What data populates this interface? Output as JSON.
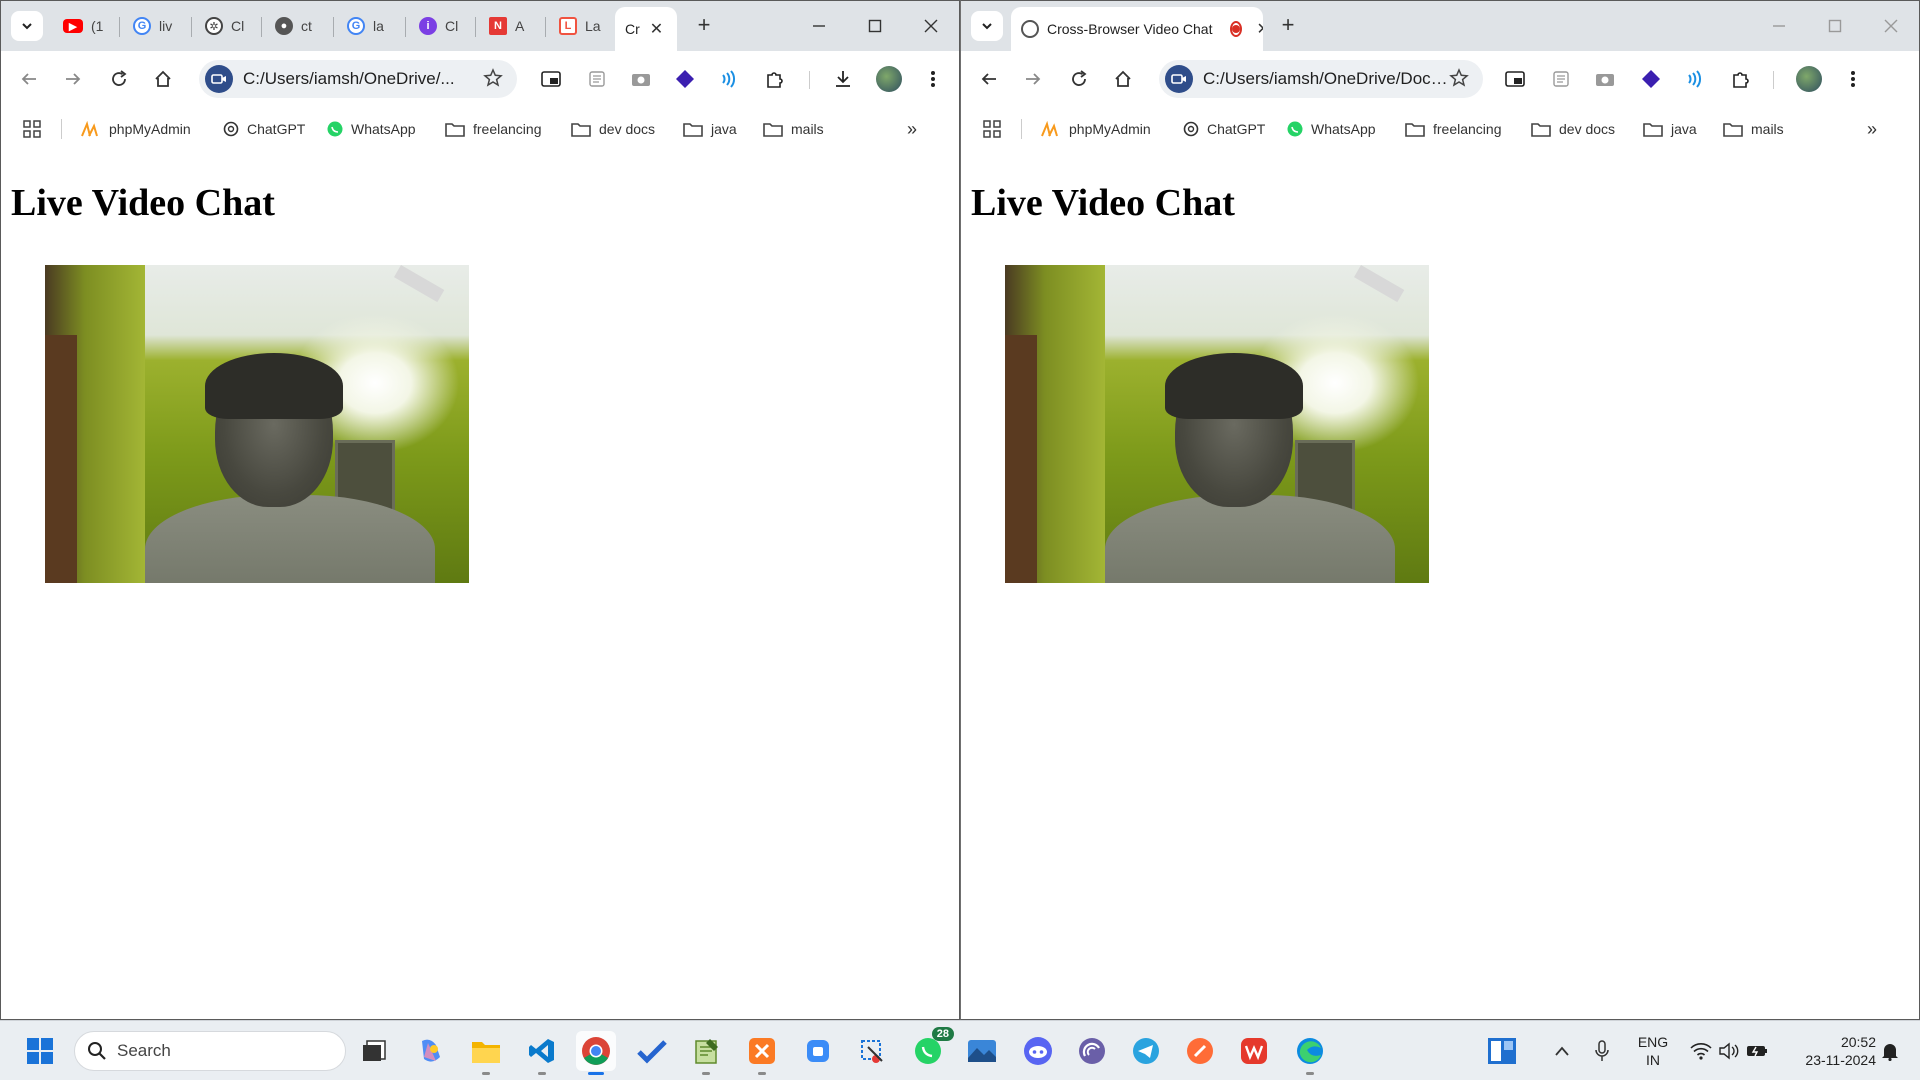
{
  "left_window": {
    "tabs": [
      {
        "label": "(1",
        "favicon": "youtube-icon",
        "color": "#ff0000"
      },
      {
        "label": "liv",
        "favicon": "google-icon",
        "color": "#4285f4"
      },
      {
        "label": "Cl",
        "favicon": "chatgpt-icon",
        "color": "#444444"
      },
      {
        "label": "ct",
        "favicon": "github-icon",
        "color": "#555555"
      },
      {
        "label": "la",
        "favicon": "google-icon",
        "color": "#4285f4"
      },
      {
        "label": "Cl",
        "favicon": "app-icon",
        "color": "#7b3fe4"
      },
      {
        "label": "A",
        "favicon": "indeed-icon",
        "color": "#e53935"
      },
      {
        "label": "La",
        "favicon": "laravel-icon",
        "color": "#f05340"
      },
      {
        "label": "Cr",
        "favicon": "",
        "color": "#ffffff"
      }
    ],
    "address": "C:/Users/iamsh/OneDrive/...",
    "page_title": "Live Video Chat"
  },
  "right_window": {
    "active_tab": "Cross-Browser Video Chat",
    "address": "C:/Users/iamsh/OneDrive/Docu...",
    "page_title": "Live Video Chat"
  },
  "bookmarks": [
    {
      "label": "phpMyAdmin",
      "icon": "phpmyadmin-icon"
    },
    {
      "label": "ChatGPT",
      "icon": "chatgpt-icon"
    },
    {
      "label": "WhatsApp",
      "icon": "whatsapp-icon"
    },
    {
      "label": "freelancing",
      "icon": "folder-icon"
    },
    {
      "label": "dev docs",
      "icon": "folder-icon"
    },
    {
      "label": "java",
      "icon": "folder-icon"
    },
    {
      "label": "mails",
      "icon": "folder-icon"
    }
  ],
  "taskbar": {
    "search_label": "Search",
    "whatsapp_badge": "28",
    "language": "ENG",
    "region": "IN",
    "time": "20:52",
    "date": "23-11-2024"
  },
  "colors": {
    "tabstrip": "#dfe3e7",
    "accent": "#1a73e8",
    "whatsapp": "#25d366"
  }
}
